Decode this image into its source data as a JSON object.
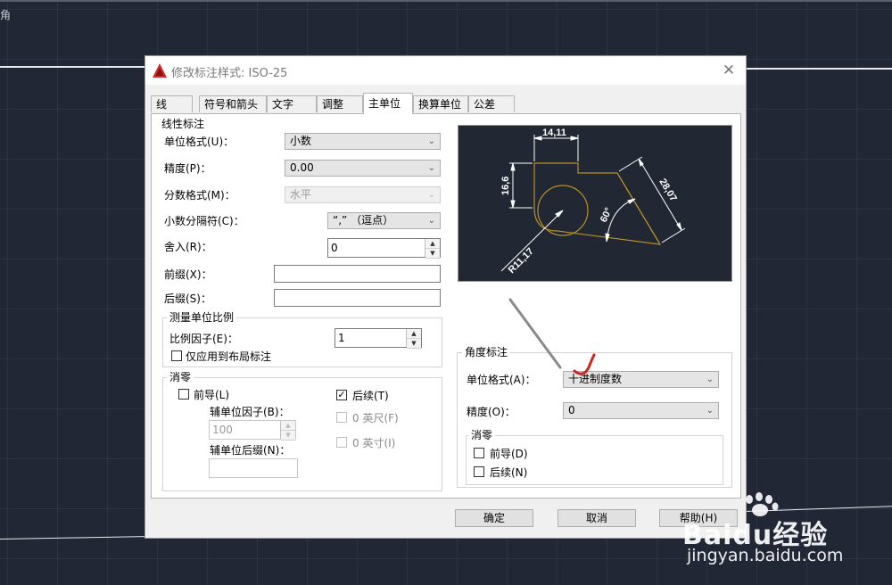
{
  "background": {
    "corner_text": "角"
  },
  "dialog": {
    "title": "修改标注样式: ISO-25",
    "close": "✕",
    "tabs": [
      "线",
      "符号和箭头",
      "文字",
      "调整",
      "主单位",
      "换算单位",
      "公差"
    ],
    "active_tab": "主单位",
    "linear": {
      "group_label": "线性标注",
      "unit_format_label": "单位格式(U)：",
      "unit_format_value": "小数",
      "precision_label": "精度(P)：",
      "precision_value": "0.00",
      "fraction_label": "分数格式(M)：",
      "fraction_value": "水平",
      "decimal_sep_label": "小数分隔符(C)：",
      "decimal_sep_value": "“,” （逗点）",
      "round_label": "舍入(R)：",
      "round_value": "0",
      "prefix_label": "前缀(X)：",
      "prefix_value": "",
      "suffix_label": "后缀(S)：",
      "suffix_value": ""
    },
    "scale": {
      "group_label": "测量单位比例",
      "factor_label": "比例因子(E)：",
      "factor_value": "1",
      "layout_only_label": "仅应用到布局标注"
    },
    "zero": {
      "group_label": "消零",
      "leading_label": "前导(L)",
      "trailing_label": "后续(T)",
      "sub_factor_label": "辅单位因子(B)：",
      "sub_factor_value": "100",
      "sub_suffix_label": "辅单位后缀(N)：",
      "sub_suffix_value": "",
      "feet_label": "0 英尺(F)",
      "inches_label": "0 英寸(I)"
    },
    "preview": {
      "dim_top": "14,11",
      "dim_left": "16,6",
      "dim_right": "28,07",
      "angle": "60°",
      "radius": "R11,17"
    },
    "angular": {
      "group_label": "角度标注",
      "unit_format_label": "单位格式(A)：",
      "unit_format_value": "十进制度数",
      "precision_label": "精度(O)：",
      "precision_value": "0",
      "zero_group_label": "消零",
      "leading_label": "前导(D)",
      "trailing_label": "后续(N)"
    },
    "buttons": {
      "ok": "确定",
      "cancel": "取消",
      "help": "帮助(H)"
    }
  },
  "watermark": {
    "logo": "Baidu经验",
    "url": "jingyan.baidu.com"
  },
  "colors": {
    "cad_bg": "#212734",
    "preview_geometry": "#b8902a",
    "annotation": "#cc2222"
  }
}
